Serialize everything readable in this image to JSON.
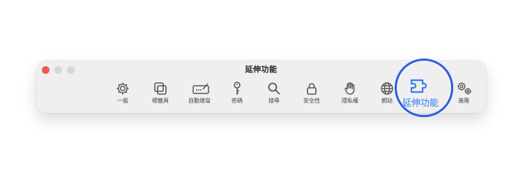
{
  "window": {
    "title": "延伸功能"
  },
  "toolbar": {
    "tabs": [
      {
        "id": "general",
        "label": "一般",
        "icon": "gear-icon"
      },
      {
        "id": "tabs",
        "label": "標籤頁",
        "icon": "tabs-icon"
      },
      {
        "id": "autofill",
        "label": "自動填寫",
        "icon": "autofill-icon"
      },
      {
        "id": "passwords",
        "label": "密碼",
        "icon": "key-icon"
      },
      {
        "id": "search",
        "label": "搜尋",
        "icon": "search-icon"
      },
      {
        "id": "security",
        "label": "安全性",
        "icon": "lock-icon"
      },
      {
        "id": "privacy",
        "label": "隱私權",
        "icon": "hand-icon"
      },
      {
        "id": "websites",
        "label": "網站",
        "icon": "globe-icon"
      },
      {
        "id": "extensions",
        "label": "延伸功能",
        "icon": "puzzle-icon",
        "selected": true
      },
      {
        "id": "advanced",
        "label": "進階",
        "icon": "advanced-gears-icon"
      }
    ]
  },
  "colors": {
    "accent": "#2f7cf6",
    "highlight_ring": "#2f58e6",
    "close": "#ec5b55",
    "inactive_button": "#d7d7d7"
  }
}
